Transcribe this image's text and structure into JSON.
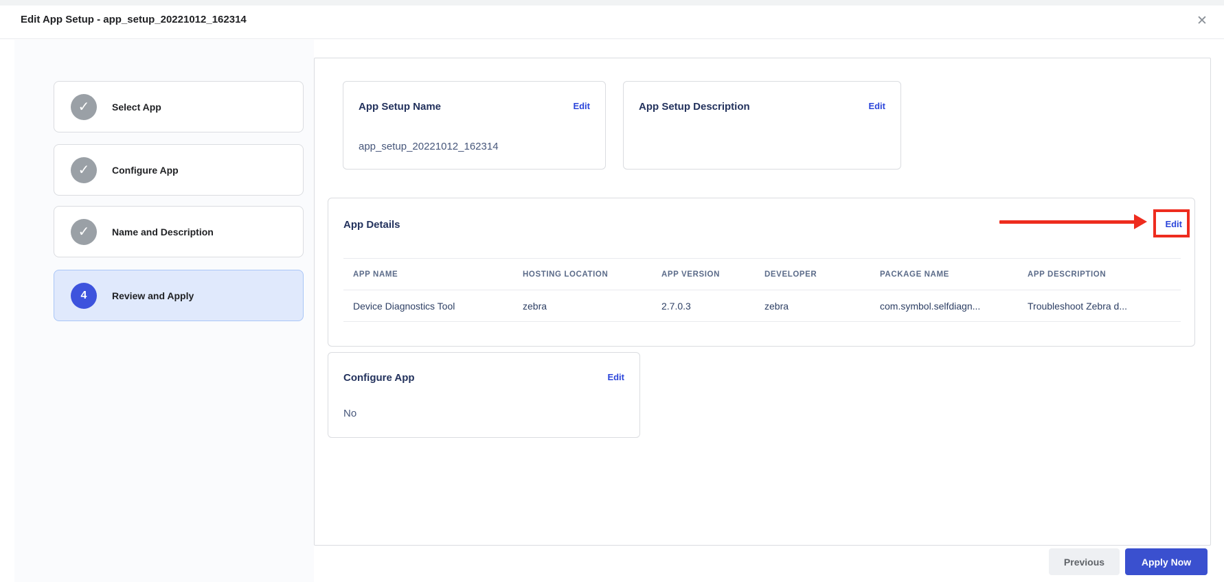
{
  "header": {
    "title": "Edit App Setup - app_setup_20221012_162314"
  },
  "icons": {
    "check": "✓",
    "close": "✕"
  },
  "steps": [
    {
      "label": "Select App",
      "status": "completed"
    },
    {
      "label": "Configure App",
      "status": "completed"
    },
    {
      "label": "Name and Description",
      "status": "completed"
    },
    {
      "label": "Review and Apply",
      "status": "active",
      "number": "4"
    }
  ],
  "cards": {
    "app_setup_name": {
      "title": "App Setup Name",
      "edit_label": "Edit",
      "value": "app_setup_20221012_162314"
    },
    "app_setup_description": {
      "title": "App Setup Description",
      "edit_label": "Edit",
      "value": ""
    },
    "app_details": {
      "title": "App Details",
      "edit_label": "Edit",
      "table": {
        "columns": [
          "APP NAME",
          "HOSTING LOCATION",
          "APP VERSION",
          "DEVELOPER",
          "PACKAGE NAME",
          "APP DESCRIPTION"
        ],
        "rows": [
          [
            "Device Diagnostics Tool",
            "zebra",
            "2.7.0.3",
            "zebra",
            "com.symbol.selfdiagn...",
            "Troubleshoot Zebra d..."
          ]
        ]
      }
    },
    "configure_app": {
      "title": "Configure App",
      "edit_label": "Edit",
      "value": "No"
    }
  },
  "annotation": {
    "type": "red-arrow-pointing-to-edit",
    "target": "app-details-edit-link",
    "color": "#ee2c1e"
  },
  "footer": {
    "previous_label": "Previous",
    "apply_label": "Apply Now"
  },
  "colors": {
    "accent_blue": "#2b45da",
    "apply_button_bg": "#3a50cf",
    "active_step_bg": "#e0e9fc",
    "active_step_circle": "#3d53dd",
    "completed_circle": "#9aa0a6",
    "annotation_red": "#ee2c1e"
  }
}
